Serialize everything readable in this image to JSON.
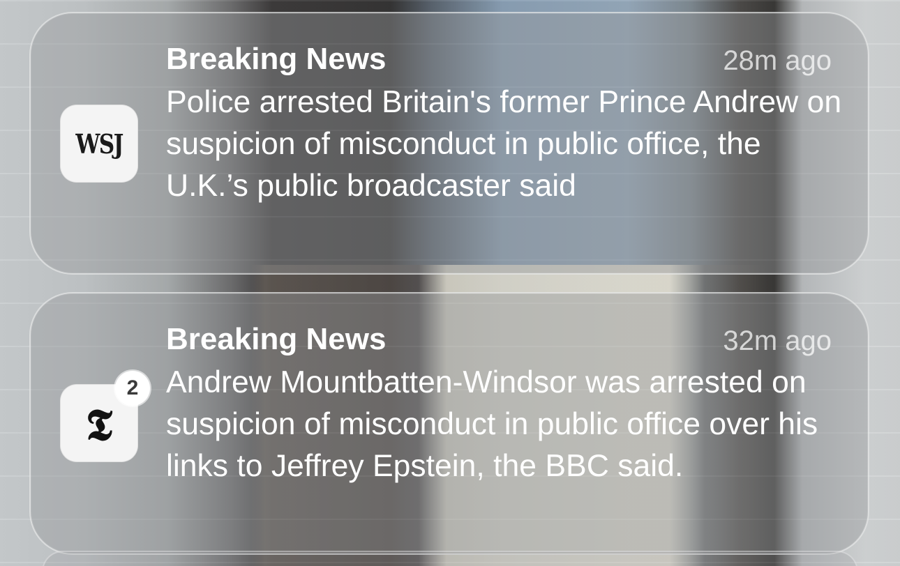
{
  "notifications": [
    {
      "app_icon": "wsj-icon",
      "icon_text": "WSJ",
      "title": "Breaking News",
      "time": "28m ago",
      "body": "Police arrested Britain's former Prince Andrew on suspicion of misconduct in public office, the U.K.’s public broadcaster said"
    },
    {
      "app_icon": "nyt-icon",
      "icon_text": "𝕿",
      "badge_count": "2",
      "title": "Breaking News",
      "time": "32m ago",
      "body": "Andrew Mountbatten-Windsor was arrested on suspicion of misconduct in public office over his links to Jeffrey Epstein, the BBC said."
    }
  ],
  "colors": {
    "card_background": "#96989a",
    "text_primary": "#ffffff",
    "icon_background": "#f4f4f4"
  }
}
